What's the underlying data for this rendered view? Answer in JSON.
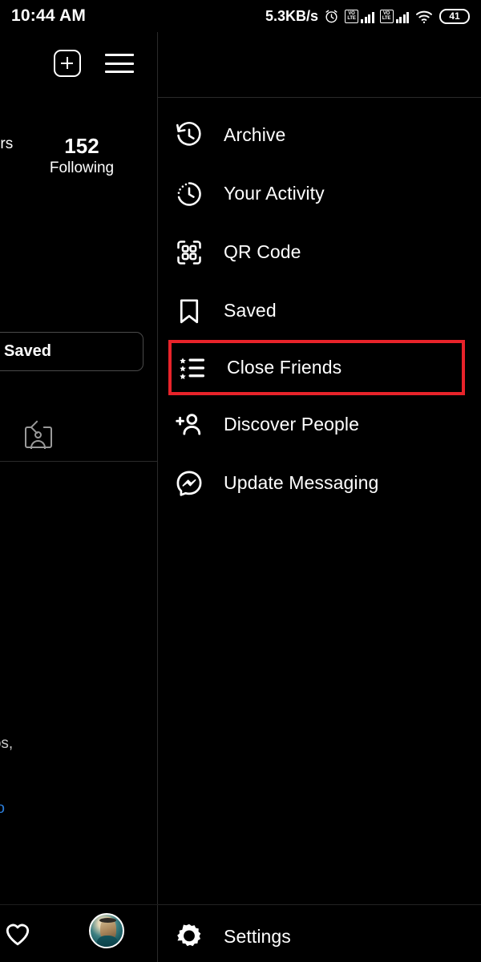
{
  "status_bar": {
    "time": "10:44 AM",
    "net_speed": "5.3KB/s",
    "alarm_icon": "alarm-clock-icon",
    "sim1_label": "VoLTE",
    "sim2_label": "VoLTE",
    "wifi_icon": "wifi-icon",
    "battery_level": "41"
  },
  "profile_panel": {
    "add_post_icon": "plus-box-icon",
    "hamburger_icon": "hamburger-menu-icon",
    "stats": [
      {
        "number": "",
        "label": "ers"
      },
      {
        "number": "152",
        "label": "Following"
      }
    ],
    "saved_button_label": "Saved",
    "highlight_icon": "story-highlight-icon",
    "bio_lines": "videos,\nfile.",
    "bio_link": "ideo"
  },
  "bottom_nav": {
    "heart_icon": "heart-icon",
    "avatar_icon": "profile-avatar"
  },
  "menu": {
    "items": [
      {
        "label": "Archive",
        "icon": "archive-clock-icon",
        "highlighted": false
      },
      {
        "label": "Your Activity",
        "icon": "activity-clock-icon",
        "highlighted": false
      },
      {
        "label": "QR Code",
        "icon": "qr-code-icon",
        "highlighted": false
      },
      {
        "label": "Saved",
        "icon": "bookmark-icon",
        "highlighted": false
      },
      {
        "label": "Close Friends",
        "icon": "star-list-icon",
        "highlighted": true
      },
      {
        "label": "Discover People",
        "icon": "person-add-icon",
        "highlighted": false
      },
      {
        "label": "Update Messaging",
        "icon": "messenger-icon",
        "highlighted": false
      }
    ],
    "footer": {
      "label": "Settings",
      "icon": "gear-icon"
    }
  },
  "colors": {
    "background": "#000000",
    "text": "#ffffff",
    "highlight_border": "#e8232a",
    "divider": "#2a2a2a",
    "link": "#2b7ddb",
    "muted_text": "#c8c8c8"
  }
}
